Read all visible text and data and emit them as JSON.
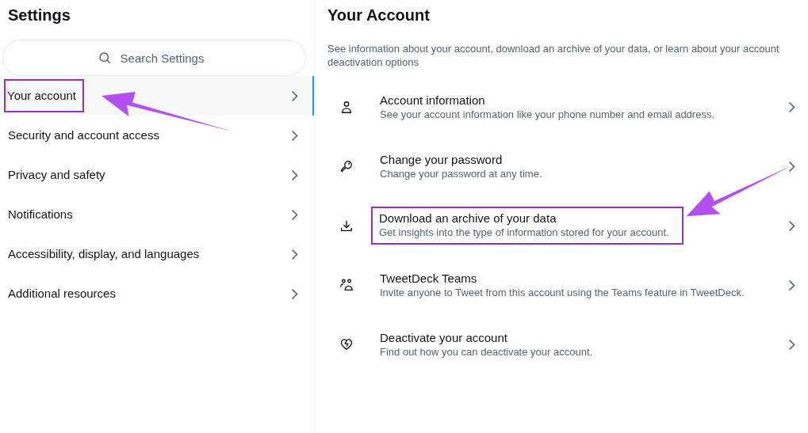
{
  "sidebar": {
    "title": "Settings",
    "search": {
      "placeholder": "Search Settings"
    },
    "items": [
      {
        "label": "Your account",
        "selected": true,
        "highlighted": true
      },
      {
        "label": "Security and account access",
        "selected": false,
        "highlighted": false
      },
      {
        "label": "Privacy and safety",
        "selected": false,
        "highlighted": false
      },
      {
        "label": "Notifications",
        "selected": false,
        "highlighted": false
      },
      {
        "label": "Accessibility, display, and languages",
        "selected": false,
        "highlighted": false
      },
      {
        "label": "Additional resources",
        "selected": false,
        "highlighted": false
      }
    ]
  },
  "main": {
    "title": "Your Account",
    "description": "See information about your account, download an archive of your data, or learn about your account deactivation options",
    "items": [
      {
        "kind": "person",
        "title": "Account information",
        "subtitle": "See your account information like your phone number and email address.",
        "highlighted": false
      },
      {
        "kind": "key",
        "title": "Change your password",
        "subtitle": "Change your password at any time.",
        "highlighted": false
      },
      {
        "kind": "download",
        "title": "Download an archive of your data",
        "subtitle": "Get insights into the type of information stored for your account.",
        "highlighted": true
      },
      {
        "kind": "people",
        "title": "TweetDeck Teams",
        "subtitle": "Invite anyone to Tweet from this account using the Teams feature in TweetDeck.",
        "highlighted": false
      },
      {
        "kind": "heart",
        "title": "Deactivate your account",
        "subtitle": "Find out how you can deactivate your account.",
        "highlighted": false
      }
    ]
  }
}
